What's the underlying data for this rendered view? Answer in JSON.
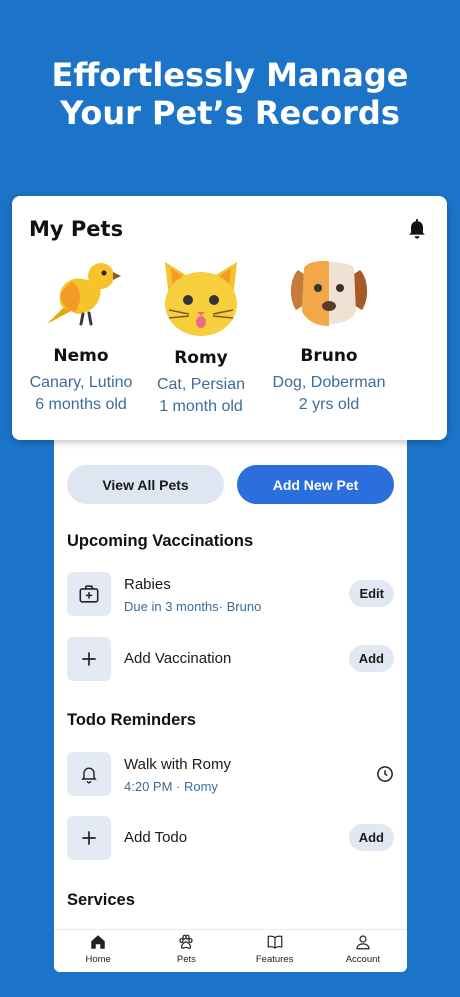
{
  "headline": {
    "line1": "Effortlessly Manage",
    "line2": "Your Pet’s Records"
  },
  "my_pets": {
    "title": "My Pets",
    "pets": [
      {
        "name": "Nemo",
        "breed": "Canary, Lutino",
        "age": "6 months old"
      },
      {
        "name": "Romy",
        "breed": "Cat, Persian",
        "age": "1 month old"
      },
      {
        "name": "Bruno",
        "breed": "Dog, Doberman",
        "age": "2 yrs old"
      }
    ]
  },
  "actions": {
    "view_all": "View All Pets",
    "add_new": "Add New Pet"
  },
  "vaccinations": {
    "title": "Upcoming Vaccinations",
    "items": [
      {
        "title": "Rabies",
        "subtitle": "Due in 3 months· Bruno",
        "action": "Edit"
      }
    ],
    "add_label": "Add Vaccination",
    "add_action": "Add"
  },
  "todos": {
    "title": "Todo Reminders",
    "items": [
      {
        "title": "Walk with Romy",
        "subtitle": "4:20 PM · Romy"
      }
    ],
    "add_label": "Add Todo",
    "add_action": "Add"
  },
  "services": {
    "title": "Services"
  },
  "tabs": [
    "Home",
    "Pets",
    "Features",
    "Account"
  ],
  "colors": {
    "background": "#1c74c8",
    "primary": "#2a6fdc",
    "secondary_text": "#3e6c98",
    "tile": "#e3eaf3"
  },
  "icons": [
    "bell-icon",
    "bird-icon",
    "cat-icon",
    "dog-icon",
    "medical-kit-icon",
    "plus-icon",
    "clock-icon",
    "home-icon",
    "paw-icon",
    "book-icon",
    "user-icon"
  ]
}
